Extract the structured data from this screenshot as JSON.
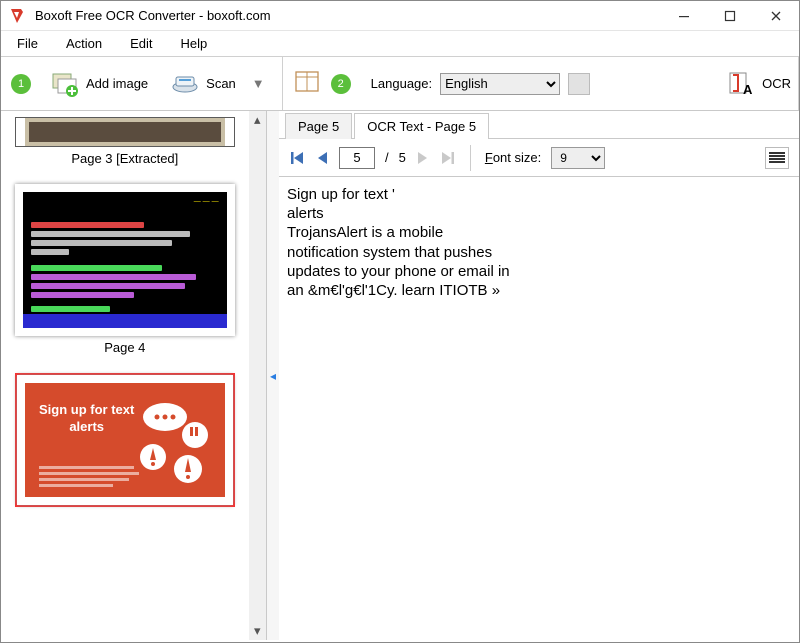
{
  "window": {
    "title": "Boxoft Free OCR Converter - boxoft.com"
  },
  "menu": {
    "file": "File",
    "action": "Action",
    "edit": "Edit",
    "help": "Help"
  },
  "toolbar": {
    "step1": "1",
    "add_image": "Add image",
    "scan": "Scan",
    "step2": "2",
    "language_label": "Language:",
    "language_value": "English",
    "ocr": "OCR"
  },
  "thumbs": {
    "page3_caption": "Page 3 [Extracted]",
    "page4_caption": "Page 4",
    "page5_headline1": "Sign up for text",
    "page5_headline2": "alerts"
  },
  "tabs": {
    "page_tab": "Page 5",
    "ocr_tab": "OCR Text - Page 5"
  },
  "pager": {
    "current": "5",
    "sep": "/",
    "total": "5",
    "fontlabel": "Font size:",
    "fontsize": "9"
  },
  "ocr_text": "Sign up for text '\nalerts\nTrojansAlert is a mobile\nnotification system that pushes\nupdates to your phone or email in\nan &m€l'g€l'1Cy. learn ITIOTB »"
}
